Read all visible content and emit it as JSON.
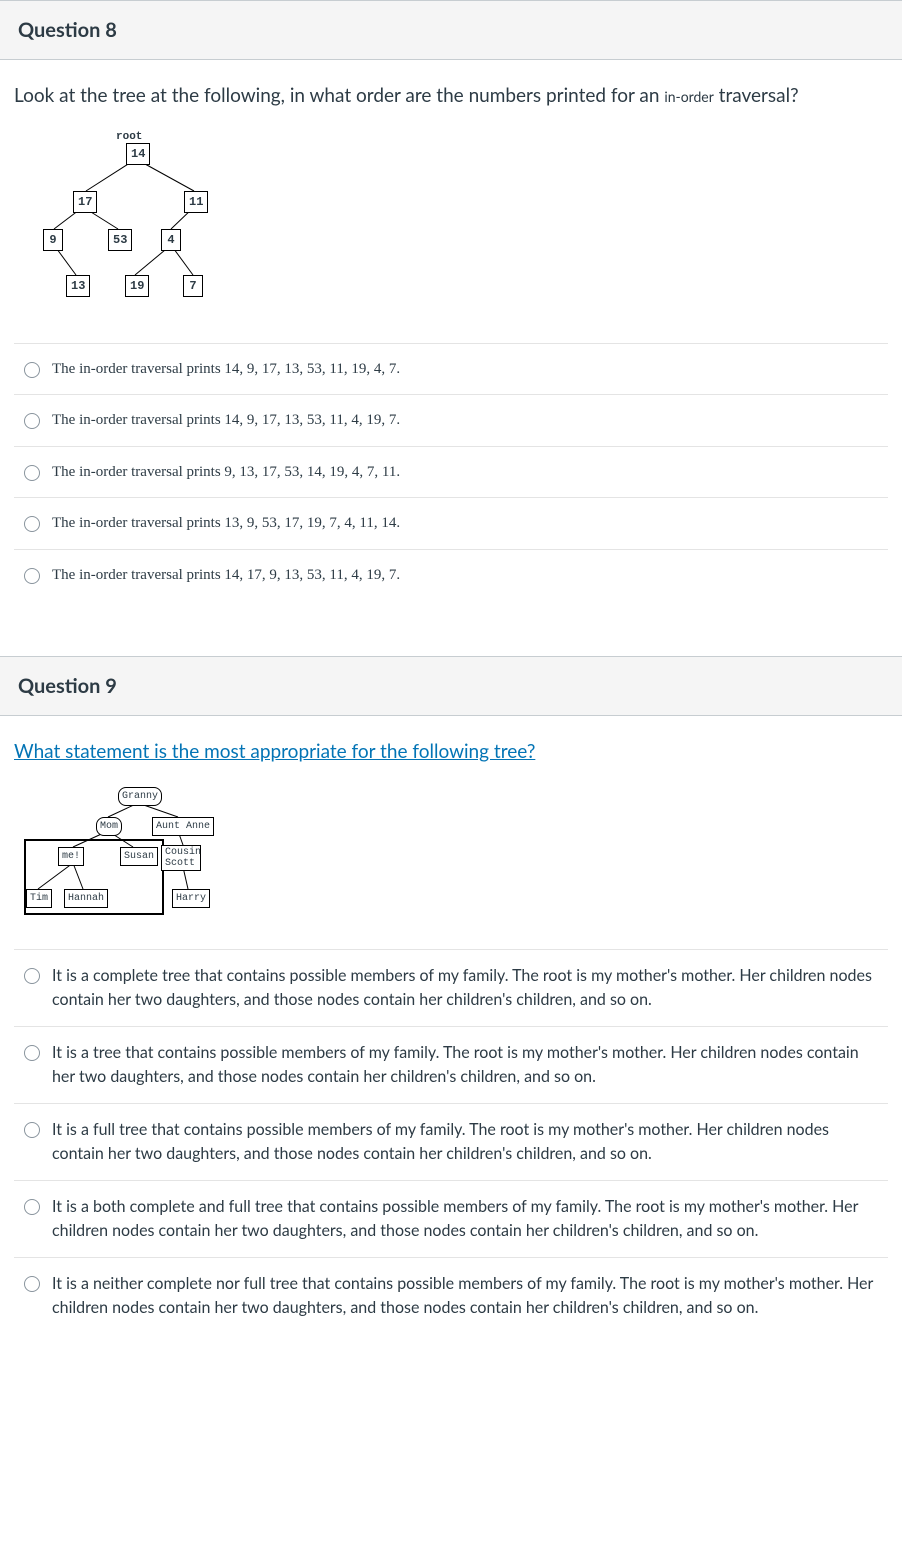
{
  "q8": {
    "title": "Question 8",
    "prompt_pre": "Look at the tree at the following, in what order are the numbers printed for an ",
    "prompt_small": "in-order",
    "prompt_post": " traversal?",
    "tree": {
      "root_label": "root",
      "n14": "14",
      "n17": "17",
      "n11": "11",
      "n9": "9",
      "n53": "53",
      "n4": "4",
      "n13": "13",
      "n19": "19",
      "n7": "7"
    },
    "answers": [
      "The in-order traversal prints 14, 9, 17, 13, 53, 11, 19, 4, 7.",
      "The in-order traversal prints 14, 9, 17, 13, 53, 11, 4, 19, 7.",
      "The in-order traversal prints 9, 13, 17, 53, 14, 19, 4, 7, 11.",
      "The in-order traversal prints 13, 9, 53, 17, 19, 7, 4, 11, 14.",
      "The in-order traversal prints 14, 17, 9, 13, 53, 11, 4, 19, 7."
    ]
  },
  "q9": {
    "title": "Question 9",
    "prompt_link": "What statement is the most appropriate for the following tree?",
    "tree": {
      "granny": "Granny",
      "mom": "Mom",
      "aunt": "Aunt Anne",
      "me": "me!",
      "susan": "Susan",
      "cousin": "Cousin Scott",
      "tim": "Tim",
      "hannah": "Hannah",
      "harry": "Harry"
    },
    "answers": [
      "It is a complete tree that contains possible members of my family. The root is my mother's mother. Her children nodes contain her two daughters, and those nodes contain her children's children, and so on.",
      "It is a tree that contains possible members of my family. The root is my mother's mother. Her children nodes contain her two daughters, and those nodes contain her children's children, and so on.",
      "It is a full tree that contains possible members of my family. The root is my mother's mother. Her children nodes contain her two daughters, and those nodes contain her children's children, and so on.",
      "It is a both complete and full tree that contains possible members of my family. The root is my mother's mother. Her children nodes contain her two daughters, and those nodes contain her children's children, and so on.",
      "It is a neither complete nor full tree that contains possible members of my family. The root is my mother's mother. Her children nodes contain her two daughters, and those nodes contain her children's children, and so on."
    ]
  }
}
